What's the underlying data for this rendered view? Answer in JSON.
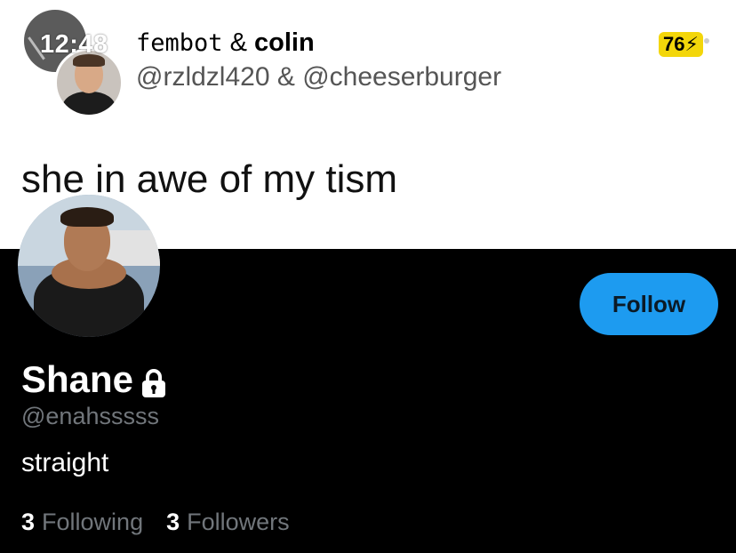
{
  "status_bar": {
    "time": "12:48",
    "battery_level": "76",
    "battery_color": "#f3d60a"
  },
  "tweet": {
    "author_names": {
      "first": "fembot",
      "separator": "&",
      "second": "colin"
    },
    "handles": "@rzldzl420 & @cheeserburger",
    "text": "she in awe of my tism"
  },
  "profile": {
    "display_name": "Shane",
    "protected_icon": "lock-icon",
    "username": "@enahsssss",
    "bio": "straight",
    "following_count": "3",
    "following_label": "Following",
    "followers_count": "3",
    "followers_label": "Followers",
    "follow_button": "Follow",
    "accent": "#1d9bf0"
  }
}
